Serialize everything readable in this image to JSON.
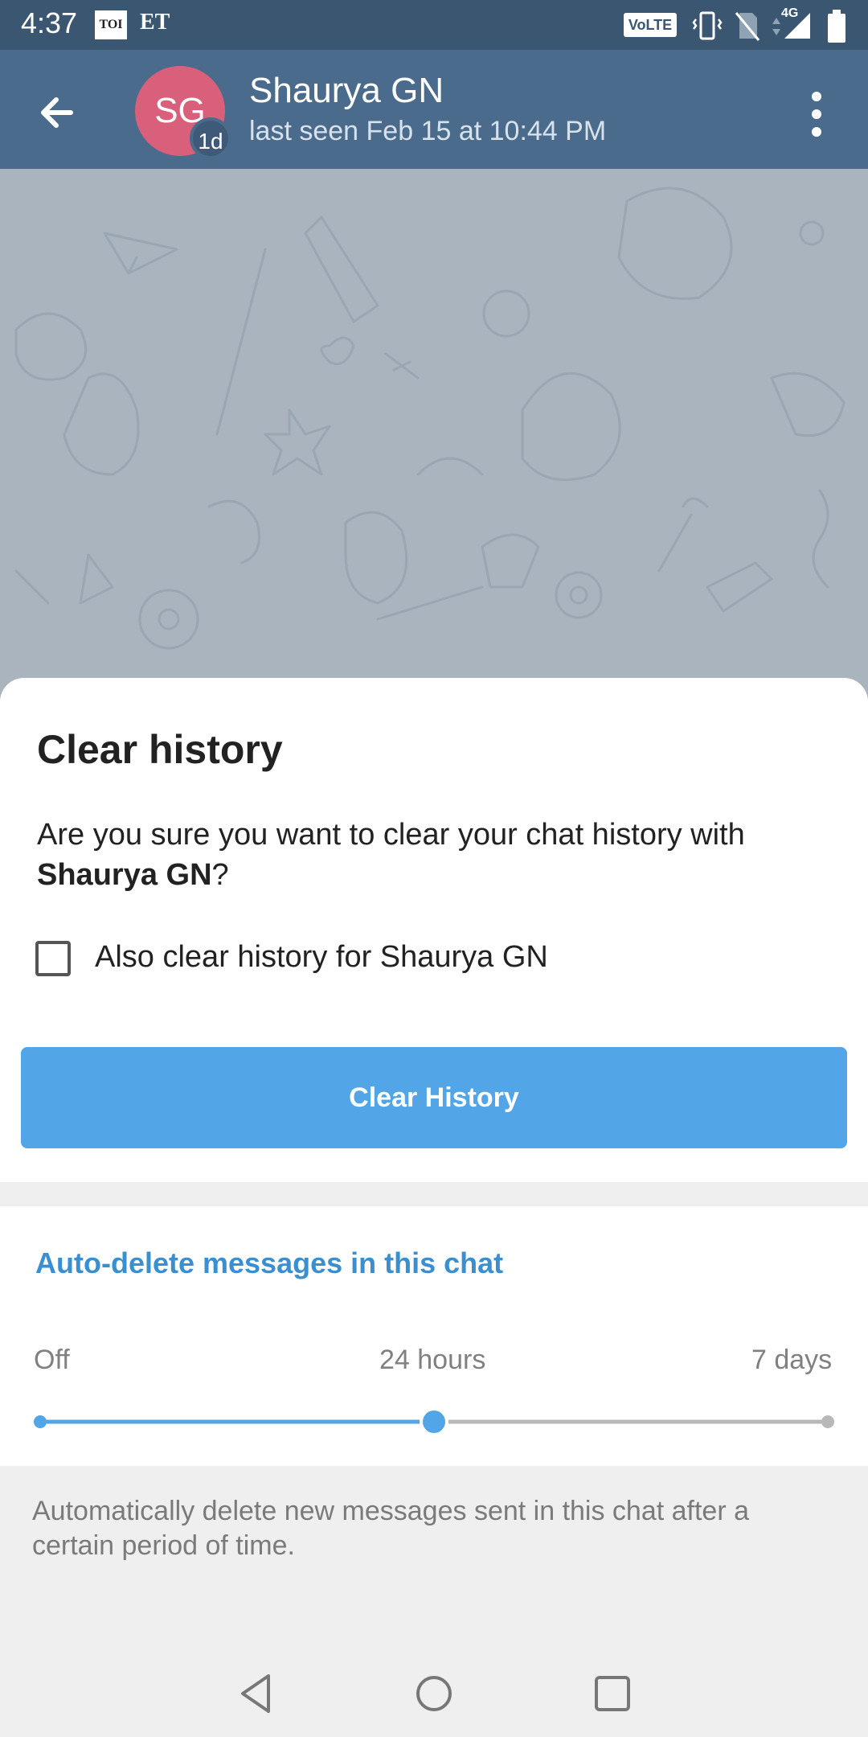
{
  "status_bar": {
    "time": "4:37",
    "notif_1": "TOI",
    "notif_2": "ET",
    "volte": "VoLTE",
    "network": "4G"
  },
  "app_bar": {
    "avatar_initials": "SG",
    "avatar_badge": "1d",
    "title": "Shaurya GN",
    "subtitle": "last seen Feb 15 at 10:44 PM"
  },
  "dialog": {
    "title": "Clear history",
    "message_prefix": "Are you sure you want to clear your chat history with ",
    "message_name": "Shaurya GN",
    "message_suffix": "?",
    "checkbox_label": "Also clear history for Shaurya GN",
    "checkbox_checked": false,
    "button_label": "Clear History"
  },
  "auto_delete": {
    "title": "Auto-delete messages in this chat",
    "options": [
      "Off",
      "24 hours",
      "7 days"
    ],
    "selected": "24 hours",
    "description": "Automatically delete new messages sent in this chat after a certain period of time."
  },
  "colors": {
    "header": "#4a6b8c",
    "accent": "#52a5e6",
    "avatar": "#d9607a"
  }
}
